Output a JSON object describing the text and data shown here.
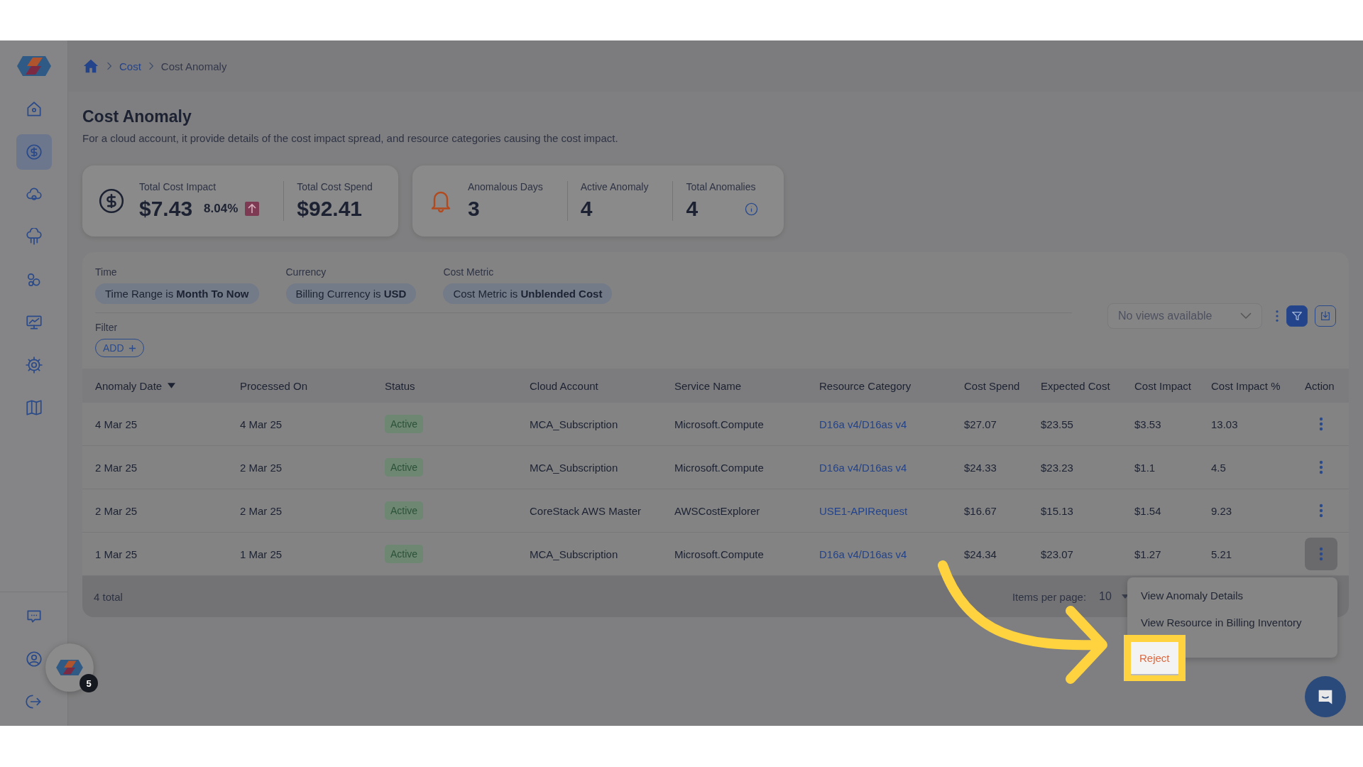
{
  "sidebar": {
    "items": [
      {
        "selected": false
      },
      {
        "selected": true
      },
      {
        "selected": false
      },
      {
        "selected": false
      },
      {
        "selected": false
      },
      {
        "selected": false
      },
      {
        "selected": false
      },
      {
        "selected": false
      }
    ],
    "bottom_items": [
      {
        "selected": false
      },
      {
        "selected": false
      },
      {
        "selected": false
      }
    ]
  },
  "breadcrumb": [
    {
      "label": "Cost",
      "current": false
    },
    {
      "label": "Cost Anomaly",
      "current": true
    }
  ],
  "page": {
    "title": "Cost Anomaly",
    "description": "For a cloud account, it provide details of the cost impact spread, and resource categories causing the cost impact."
  },
  "summary_cards": [
    {
      "kind": "cost",
      "stats": [
        {
          "label": "Total Cost Impact",
          "value": "$7.43",
          "change": "8.04%",
          "info": false
        },
        {
          "label": "Total Cost Spend",
          "value": "$92.41",
          "info": false
        }
      ]
    },
    {
      "kind": "alert",
      "stats": [
        {
          "label": "Anomalous Days",
          "value": "3",
          "info": false
        },
        {
          "label": "Active Anomaly",
          "value": "4",
          "info": false
        },
        {
          "label": "Total Anomalies",
          "value": "4",
          "info": true
        }
      ]
    }
  ],
  "filters": {
    "groups": [
      {
        "label": "Time",
        "prefix": "Time Range is",
        "value": "Month To Now"
      },
      {
        "label": "Currency",
        "prefix": "Billing Currency is",
        "value": "USD"
      },
      {
        "label": "Cost Metric",
        "prefix": "Cost Metric is",
        "value": "Unblended Cost"
      }
    ],
    "filter_label": "Filter",
    "add_button": "ADD",
    "views_select": {
      "placeholder": "No views available"
    },
    "filter_toggle_on": true
  },
  "table": {
    "columns": [
      {
        "label": "Anomaly Date",
        "sorted": true
      },
      {
        "label": "Processed On",
        "sorted": false
      },
      {
        "label": "Status",
        "sorted": false
      },
      {
        "label": "Cloud Account",
        "sorted": false
      },
      {
        "label": "Service Name",
        "sorted": false
      },
      {
        "label": "Resource Category",
        "sorted": false
      },
      {
        "label": "Cost Spend",
        "sorted": false
      },
      {
        "label": "Expected Cost",
        "sorted": false
      },
      {
        "label": "Cost Impact",
        "sorted": false
      },
      {
        "label": "Cost Impact %",
        "sorted": false
      },
      {
        "label": "Action",
        "sorted": false
      }
    ],
    "rows": [
      {
        "anomaly_date": "4 Mar 25",
        "processed_on": "4 Mar 25",
        "status": "Active",
        "cloud_account": "MCA_Subscription",
        "service_name": "Microsoft.Compute",
        "resource_category": "D16a v4/D16as v4",
        "cost_spend": "$27.07",
        "expected_cost": "$23.55",
        "cost_impact": "$3.53",
        "cost_impact_pct": "13.03",
        "menu_open": false
      },
      {
        "anomaly_date": "2 Mar 25",
        "processed_on": "2 Mar 25",
        "status": "Active",
        "cloud_account": "MCA_Subscription",
        "service_name": "Microsoft.Compute",
        "resource_category": "D16a v4/D16as v4",
        "cost_spend": "$24.33",
        "expected_cost": "$23.23",
        "cost_impact": "$1.1",
        "cost_impact_pct": "4.5",
        "menu_open": false
      },
      {
        "anomaly_date": "2 Mar 25",
        "processed_on": "2 Mar 25",
        "status": "Active",
        "cloud_account": "CoreStack AWS Master",
        "service_name": "AWSCostExplorer",
        "resource_category": "USE1-APIRequest",
        "cost_spend": "$16.67",
        "expected_cost": "$15.13",
        "cost_impact": "$1.54",
        "cost_impact_pct": "9.23",
        "menu_open": false
      },
      {
        "anomaly_date": "1 Mar 25",
        "processed_on": "1 Mar 25",
        "status": "Active",
        "cloud_account": "MCA_Subscription",
        "service_name": "Microsoft.Compute",
        "resource_category": "D16a v4/D16as v4",
        "cost_spend": "$24.34",
        "expected_cost": "$23.07",
        "cost_impact": "$1.27",
        "cost_impact_pct": "5.21",
        "menu_open": true
      }
    ],
    "footer": {
      "total": "4 total",
      "items_per_page_label": "Items per page:",
      "items_per_page": "10"
    }
  },
  "action_menu": {
    "items": [
      {
        "label": "View Anomaly Details",
        "kind": "normal",
        "highlighted": false
      },
      {
        "label": "View Resource in Billing Inventory",
        "kind": "normal",
        "highlighted": false
      },
      {
        "label": "Reject",
        "kind": "danger",
        "highlighted": true
      }
    ]
  },
  "notification_badge": "5"
}
